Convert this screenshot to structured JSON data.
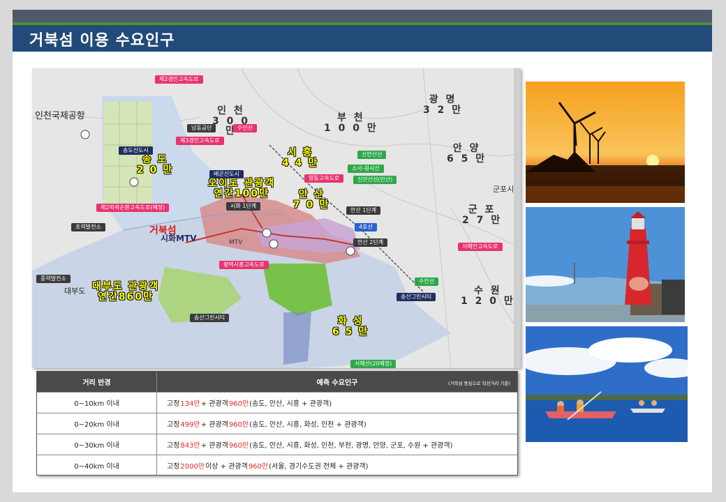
{
  "header": {
    "title": "거북섬 이용 수요인구"
  },
  "map": {
    "airport": "인천국제공항",
    "cities": [
      {
        "id": "incheon",
        "text": "인 천\n3 0 0\n만"
      },
      {
        "id": "bucheon",
        "text": "부 천\n1 0 0 만"
      },
      {
        "id": "gwangmyeong",
        "text": "광 명\n3 2 만"
      },
      {
        "id": "anyang",
        "text": "안 양\n6 5 만"
      },
      {
        "id": "gunpo",
        "text": "군 포\n2 7 만"
      },
      {
        "id": "suwon",
        "text": "수 원\n1 2 0 만"
      },
      {
        "id": "gunpo-station",
        "text": "군포시"
      }
    ],
    "highlights": [
      {
        "id": "songdo",
        "text": "송 도\n2 0 만"
      },
      {
        "id": "siheung",
        "text": "시 흥\n4 4 만"
      },
      {
        "id": "oido",
        "text": "오이도 관광객\n연간100만"
      },
      {
        "id": "ansan",
        "text": "안 산\n7 0 만"
      },
      {
        "id": "daebudo",
        "text": "대부도 관광객\n연간860만"
      },
      {
        "id": "hwaseong",
        "text": "화 성\n6 5 만"
      }
    ],
    "tags": [
      {
        "id": "road2",
        "text": "제2경인고속도로",
        "color": "pink"
      },
      {
        "id": "namdong",
        "text": "남동공단",
        "color": "dark"
      },
      {
        "id": "suin",
        "text": "수인선",
        "color": "pink"
      },
      {
        "id": "road3",
        "text": "제3경인고속도로",
        "color": "pink"
      },
      {
        "id": "songdo-new",
        "text": "송도신도시",
        "color": "navy"
      },
      {
        "id": "sinansan",
        "text": "신안산선",
        "color": "green"
      },
      {
        "id": "sosa",
        "text": "소사-원시선",
        "color": "green"
      },
      {
        "id": "baegot",
        "text": "배곧신도시",
        "color": "navy"
      },
      {
        "id": "youngdong",
        "text": "영동고속도로",
        "color": "pink"
      },
      {
        "id": "sinansan2",
        "text": "신안산선(안산)",
        "color": "green"
      },
      {
        "id": "road2-west",
        "text": "제2외곽순환고속도로(예정)",
        "color": "pink"
      },
      {
        "id": "sihwa1",
        "text": "시화 1단계",
        "color": "dark"
      },
      {
        "id": "ansan1",
        "text": "안산 1단계",
        "color": "dark"
      },
      {
        "id": "tidal",
        "text": "조력발전소",
        "color": "dark"
      },
      {
        "id": "line4",
        "text": "4호선",
        "color": "blue"
      },
      {
        "id": "ansan2",
        "text": "안산 2단계",
        "color": "dark"
      },
      {
        "id": "seohae",
        "text": "서해안고속도로",
        "color": "pink"
      },
      {
        "id": "pyeongtaek",
        "text": "평택시흥고속도로",
        "color": "pink"
      },
      {
        "id": "tidal2",
        "text": "풍력발전소",
        "color": "dark"
      },
      {
        "id": "suin2",
        "text": "수인선",
        "color": "green"
      },
      {
        "id": "songsan",
        "text": "송산그린시티",
        "color": "navy"
      },
      {
        "id": "songsan2",
        "text": "송산그린시티",
        "color": "dark"
      },
      {
        "id": "seohae2",
        "text": "서해선(20예정)",
        "color": "green"
      }
    ],
    "turtle_island": "거북섬",
    "sihwa_mtv": "시화MTV",
    "mtv_small": "MTV",
    "daebudo_label": "대부도"
  },
  "table": {
    "header": {
      "col1": "거리 반경",
      "col2": "예측 수요인구",
      "note": "(거북섬 중심으로 직선거리 기준)"
    },
    "rows": [
      {
        "range": "0~10km 이내",
        "pre": "고정 ",
        "fixed": "134만",
        "mid": " + 관광객 ",
        "tourist": "960만",
        "post": " (송도, 안산, 시흥 + 관광객)"
      },
      {
        "range": "0~20km 이내",
        "pre": "고정 ",
        "fixed": "499만",
        "mid": " + 관광객 ",
        "tourist": "960만",
        "post": " (송도, 안산, 시흥, 화성, 인천 + 관광객)"
      },
      {
        "range": "0~30km 이내",
        "pre": "고정 ",
        "fixed": "843만",
        "mid": " + 관광객 ",
        "tourist": "960만",
        "post": " (송도, 안산, 시흥, 화성, 인천, 부천, 광명, 안양, 군포, 수원 + 관광객)"
      },
      {
        "range": "0~40km 이내",
        "pre": "고정 ",
        "fixed": "2000만",
        "mid": " 이상 + 관광객 ",
        "tourist": "960만",
        "post": " (서울, 경기수도권 전체 + 관광객)"
      }
    ]
  },
  "colors": {
    "title_bar": "#224b7a",
    "accent_green": "#4f8f3a",
    "highlight_red": "#e0262b"
  }
}
